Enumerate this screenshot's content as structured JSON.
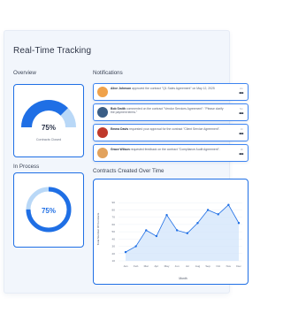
{
  "page": {
    "title": "Real-Time Tracking"
  },
  "overview": {
    "heading": "Overview",
    "percent_label": "75%",
    "percent_value": 75,
    "caption": "Contracts Closed"
  },
  "in_process": {
    "heading": "In Process",
    "percent_label": "75%",
    "percent_value": 75
  },
  "notifications": {
    "heading": "Notifications",
    "items": [
      {
        "name": "Alice Johnson",
        "text": "approved the contract \"Q1 Sales Agreement\" on May 12, 2025",
        "time": "2m",
        "avatar_color": "#f0a24a"
      },
      {
        "name": "Bob Smith",
        "text": "commented on the contract \"Vendor Services Agreement\": \"Please clarify the payment terms.\"",
        "time": "5m",
        "avatar_color": "#3a5e86"
      },
      {
        "name": "Emma Davis",
        "text": "requested your approval for the contract \"Client Service Agreement\".",
        "time": "1h",
        "avatar_color": "#c0392b"
      },
      {
        "name": "Grace Wilson",
        "text": "requested feedback on the contract \"Compliance Audit Agreement\".",
        "time": "3h",
        "avatar_color": "#e2a25c"
      }
    ]
  },
  "colors": {
    "accent": "#1f6fe5",
    "accent_light": "#b9d8f7",
    "track": "#e6edf7"
  },
  "chart_data": {
    "type": "area",
    "title": "Contracts Created Over Time",
    "xlabel": "Month",
    "ylabel": "Total Number Of Contracts",
    "categories": [
      "Jan",
      "Feb",
      "Mar",
      "Apr",
      "May",
      "Jun",
      "Jul",
      "Aug",
      "Sep",
      "Oct",
      "Nov",
      "Dec"
    ],
    "values": [
      22,
      30,
      52,
      44,
      73,
      52,
      48,
      62,
      80,
      74,
      87,
      62
    ],
    "yticks": [
      10,
      20,
      30,
      40,
      50,
      60,
      70,
      80,
      90
    ],
    "ylim": [
      10,
      100
    ],
    "grid": true,
    "legend": "none"
  }
}
